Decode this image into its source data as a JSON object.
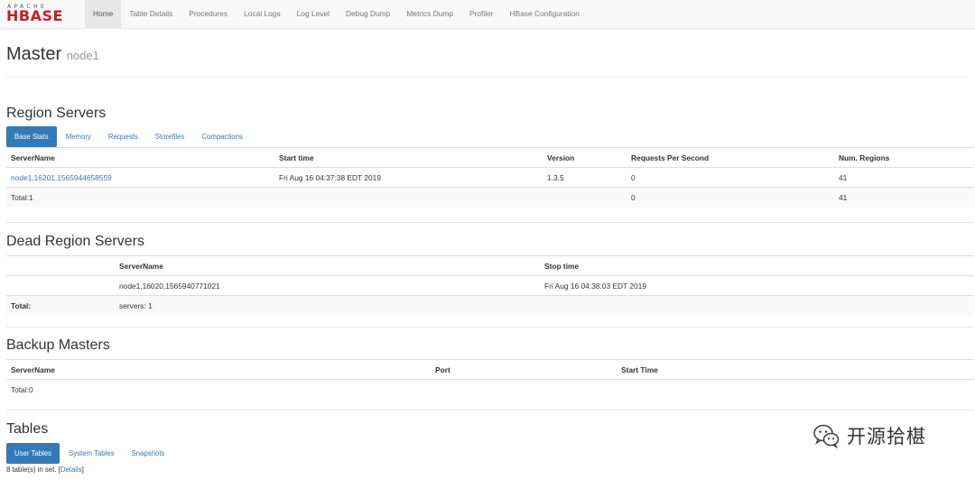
{
  "brand": {
    "top": "APACHE",
    "name": "HBASE"
  },
  "nav": {
    "items": [
      "Home",
      "Table Details",
      "Procedures",
      "Local Logs",
      "Log Level",
      "Debug Dump",
      "Metrics Dump",
      "Profiler",
      "HBase Configuration"
    ],
    "active": "Home"
  },
  "header": {
    "title": "Master",
    "host": "node1"
  },
  "region_servers": {
    "title": "Region Servers",
    "tabs": [
      "Base Stats",
      "Memory",
      "Requests",
      "Storefiles",
      "Compactions"
    ],
    "columns": [
      "ServerName",
      "Start time",
      "Version",
      "Requests Per Second",
      "Num. Regions"
    ],
    "rows": [
      {
        "server": "node1,16201,1565944658559",
        "start": "Fri Aug 16 04:37:38 EDT 2019",
        "version": "1.3.5",
        "rps": "0",
        "regions": "41"
      }
    ],
    "total": {
      "label": "Total:1",
      "rps": "0",
      "regions": "41"
    }
  },
  "dead_region_servers": {
    "title": "Dead Region Servers",
    "columns": [
      "ServerName",
      "Stop time"
    ],
    "rows": [
      {
        "server": "node1,16020,1565940771021",
        "stop": "Fri Aug 16 04:38:03 EDT 2019"
      }
    ],
    "total": {
      "label": "Total:",
      "servers": "servers: 1"
    }
  },
  "backup_masters": {
    "title": "Backup Masters",
    "columns": [
      "ServerName",
      "Port",
      "Start Time"
    ],
    "total": "Total:0"
  },
  "tables": {
    "title": "Tables",
    "tabs": [
      "User Tables",
      "System Tables",
      "Snapshots"
    ],
    "count_text": "8 table(s) in set. [",
    "details_link": "Details",
    "count_close": "]"
  },
  "watermark": {
    "text": "开源拾椹",
    "icon": "wechat-icon"
  },
  "colors": {
    "accent": "#337ab7",
    "brand_red": "#c41f26",
    "navbar_bg": "#f8f8f8"
  }
}
